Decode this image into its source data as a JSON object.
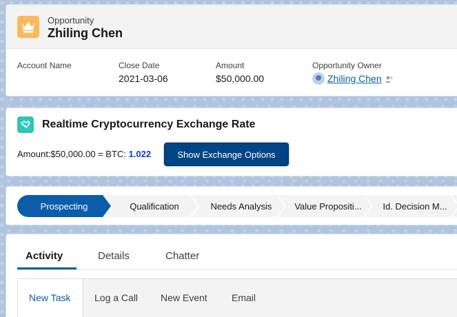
{
  "header": {
    "object_label": "Opportunity",
    "record_name": "Zhiling Chen",
    "fields": [
      {
        "label": "Account Name",
        "value": ""
      },
      {
        "label": "Close Date",
        "value": "2021-03-06"
      },
      {
        "label": "Amount",
        "value": "$50,000.00"
      },
      {
        "label": "Opportunity Owner",
        "value": "Zhiling Chen"
      }
    ]
  },
  "crypto": {
    "title": "Realtime Cryptocurrency Exchange Rate",
    "amount_text": "Amount:$50,000.00 = BTC: ",
    "btc_value": "1.022",
    "button_label": "Show Exchange Options"
  },
  "path": {
    "stages": [
      "Prospecting",
      "Qualification",
      "Needs Analysis",
      "Value Propositi...",
      "Id. Decision M...",
      ""
    ],
    "active_index": 0
  },
  "tabs": {
    "items": [
      "Activity",
      "Details",
      "Chatter"
    ],
    "active_index": 0
  },
  "activity": {
    "subtabs": [
      "New Task",
      "Log a Call",
      "New Event",
      "Email"
    ],
    "active_index": 0
  },
  "colors": {
    "brand_blue": "#0b5cab",
    "button_dark": "#014486",
    "opportunity_icon": "#fcb95b",
    "crypto_icon": "#2fc6b3"
  }
}
